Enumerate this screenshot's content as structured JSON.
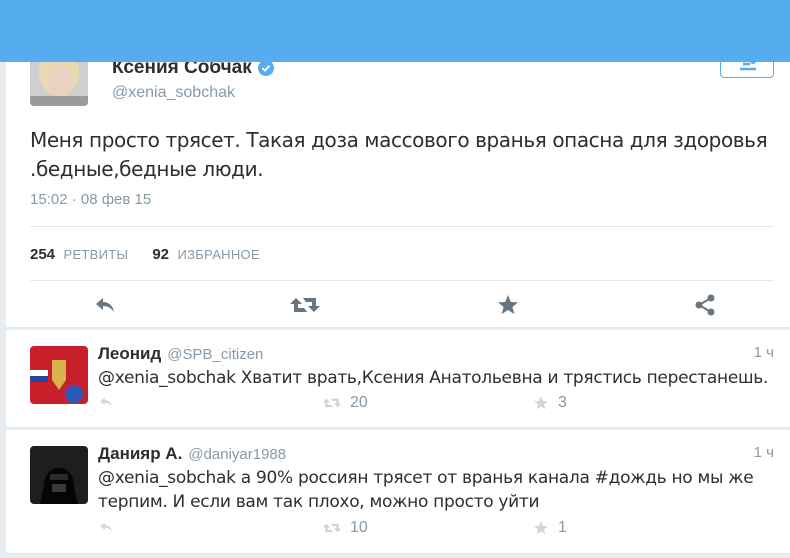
{
  "colors": {
    "accent": "#55acee",
    "muted": "#8899a6",
    "text": "#292f33",
    "border": "#e1e8ed"
  },
  "tweet": {
    "author_name": "Ксения Собчак",
    "author_handle": "@xenia_sobchak",
    "text_line1": "Меня просто трясет. Такая доза массового вранья опасна для здоровья",
    "text_line2": ".бедные,бедные люди.",
    "timestamp": "15:02 · 08 фев 15",
    "retweets_count": "254",
    "retweets_label": "РЕТВИТЫ",
    "favorites_count": "92",
    "favorites_label": "ИЗБРАННОЕ"
  },
  "replies": [
    {
      "name": "Леонид",
      "handle": "@SPB_citizen",
      "time": "1 ч",
      "text": "@xenia_sobchak Хватит врать,Ксения Анатольевна и трястись перестанешь.",
      "retweets": "20",
      "favorites": "3"
    },
    {
      "name": "Данияр А.",
      "handle": "@daniyar1988",
      "time": "1 ч",
      "text": "@xenia_sobchak а 90% россиян трясет от вранья канала #дождь но мы же терпим. И если вам так плохо, можно просто уйти",
      "retweets": "10",
      "favorites": "1"
    }
  ]
}
